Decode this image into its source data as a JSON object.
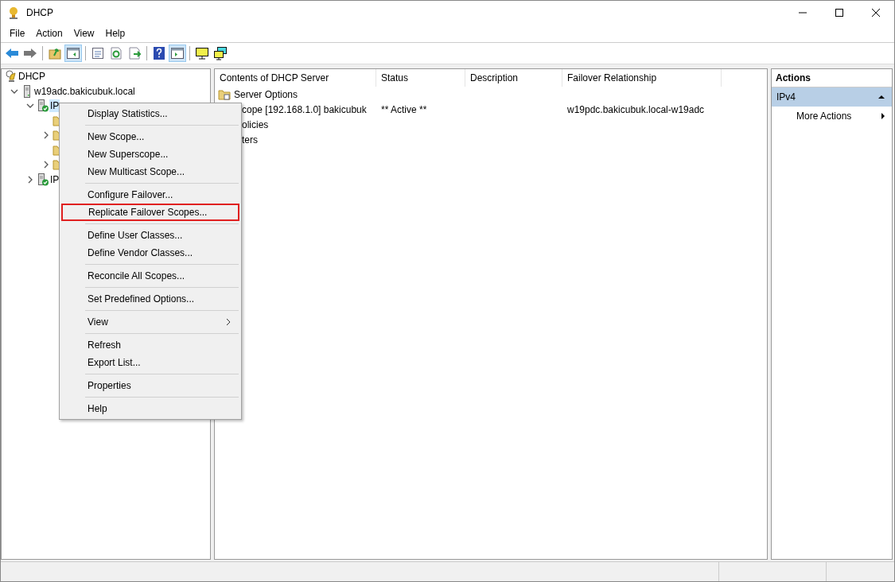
{
  "window": {
    "title": "DHCP"
  },
  "menu_bar": [
    "File",
    "Action",
    "View",
    "Help"
  ],
  "toolbar": [
    {
      "kind": "back",
      "selected": false
    },
    {
      "kind": "forward",
      "selected": false
    },
    {
      "kind": "separator"
    },
    {
      "kind": "up",
      "selected": false
    },
    {
      "kind": "tree-pane",
      "selected": true
    },
    {
      "kind": "separator"
    },
    {
      "kind": "properties",
      "selected": false
    },
    {
      "kind": "refresh",
      "selected": false
    },
    {
      "kind": "export",
      "selected": false
    },
    {
      "kind": "separator"
    },
    {
      "kind": "help",
      "selected": false
    },
    {
      "kind": "action-pane",
      "selected": true
    },
    {
      "kind": "separator"
    },
    {
      "kind": "monitor",
      "selected": false
    },
    {
      "kind": "monitors",
      "selected": false
    }
  ],
  "tree": [
    {
      "label": "DHCP",
      "kind": "root",
      "selected": false,
      "children": [
        {
          "label": "w19adc.bakicubuk.local",
          "kind": "server",
          "expanded": true,
          "selected": false,
          "children": [
            {
              "label": "IP",
              "kind": "protocol",
              "expanded": true,
              "selected": true,
              "children": [
                {
                  "expandable": false
                },
                {
                  "expandable": true,
                  "expanded": false
                },
                {
                  "expandable": false
                },
                {
                  "expandable": true,
                  "expanded": false
                }
              ]
            },
            {
              "label": "IP",
              "kind": "protocol",
              "expanded": false,
              "selected": false
            }
          ]
        }
      ]
    }
  ],
  "table": {
    "columns": [
      "Contents of DHCP Server",
      "Status",
      "Description",
      "Failover Relationship"
    ],
    "rows": [
      {
        "kind": "options",
        "cells": [
          "Server Options",
          "",
          "",
          ""
        ]
      },
      {
        "kind": "covered",
        "cells": [
          "cope [192.168.1.0] bakicubuk",
          "** Active **",
          "",
          "w19pdc.bakicubuk.local-w19adc"
        ]
      },
      {
        "kind": "covered",
        "cells": [
          "olicies",
          "",
          "",
          ""
        ]
      },
      {
        "kind": "covered",
        "cells": [
          "ters",
          "",
          "",
          ""
        ]
      }
    ]
  },
  "context_menu": [
    [
      {
        "label": "Display Statistics...",
        "highlighted": false
      }
    ],
    [
      {
        "label": "New Scope...",
        "highlighted": false
      },
      {
        "label": "New Superscope...",
        "highlighted": false
      },
      {
        "label": "New Multicast Scope...",
        "highlighted": false
      }
    ],
    [
      {
        "label": "Configure Failover...",
        "highlighted": false
      },
      {
        "label": "Replicate Failover Scopes...",
        "highlighted": true
      }
    ],
    [
      {
        "label": "Define User Classes...",
        "highlighted": false
      },
      {
        "label": "Define Vendor Classes...",
        "highlighted": false
      }
    ],
    [
      {
        "label": "Reconcile All Scopes...",
        "highlighted": false
      }
    ],
    [
      {
        "label": "Set Predefined Options...",
        "highlighted": false
      }
    ],
    [
      {
        "label": "View",
        "highlighted": false,
        "submenu": true
      }
    ],
    [
      {
        "label": "Refresh",
        "highlighted": false
      },
      {
        "label": "Export List...",
        "highlighted": false
      }
    ],
    [
      {
        "label": "Properties",
        "highlighted": false
      }
    ],
    [
      {
        "label": "Help",
        "highlighted": false
      }
    ]
  ],
  "actions": {
    "title": "Actions",
    "sections": [
      {
        "title": "IPv4",
        "expanded": true,
        "items": [
          {
            "label": "More Actions",
            "submenu": true
          }
        ]
      }
    ]
  }
}
